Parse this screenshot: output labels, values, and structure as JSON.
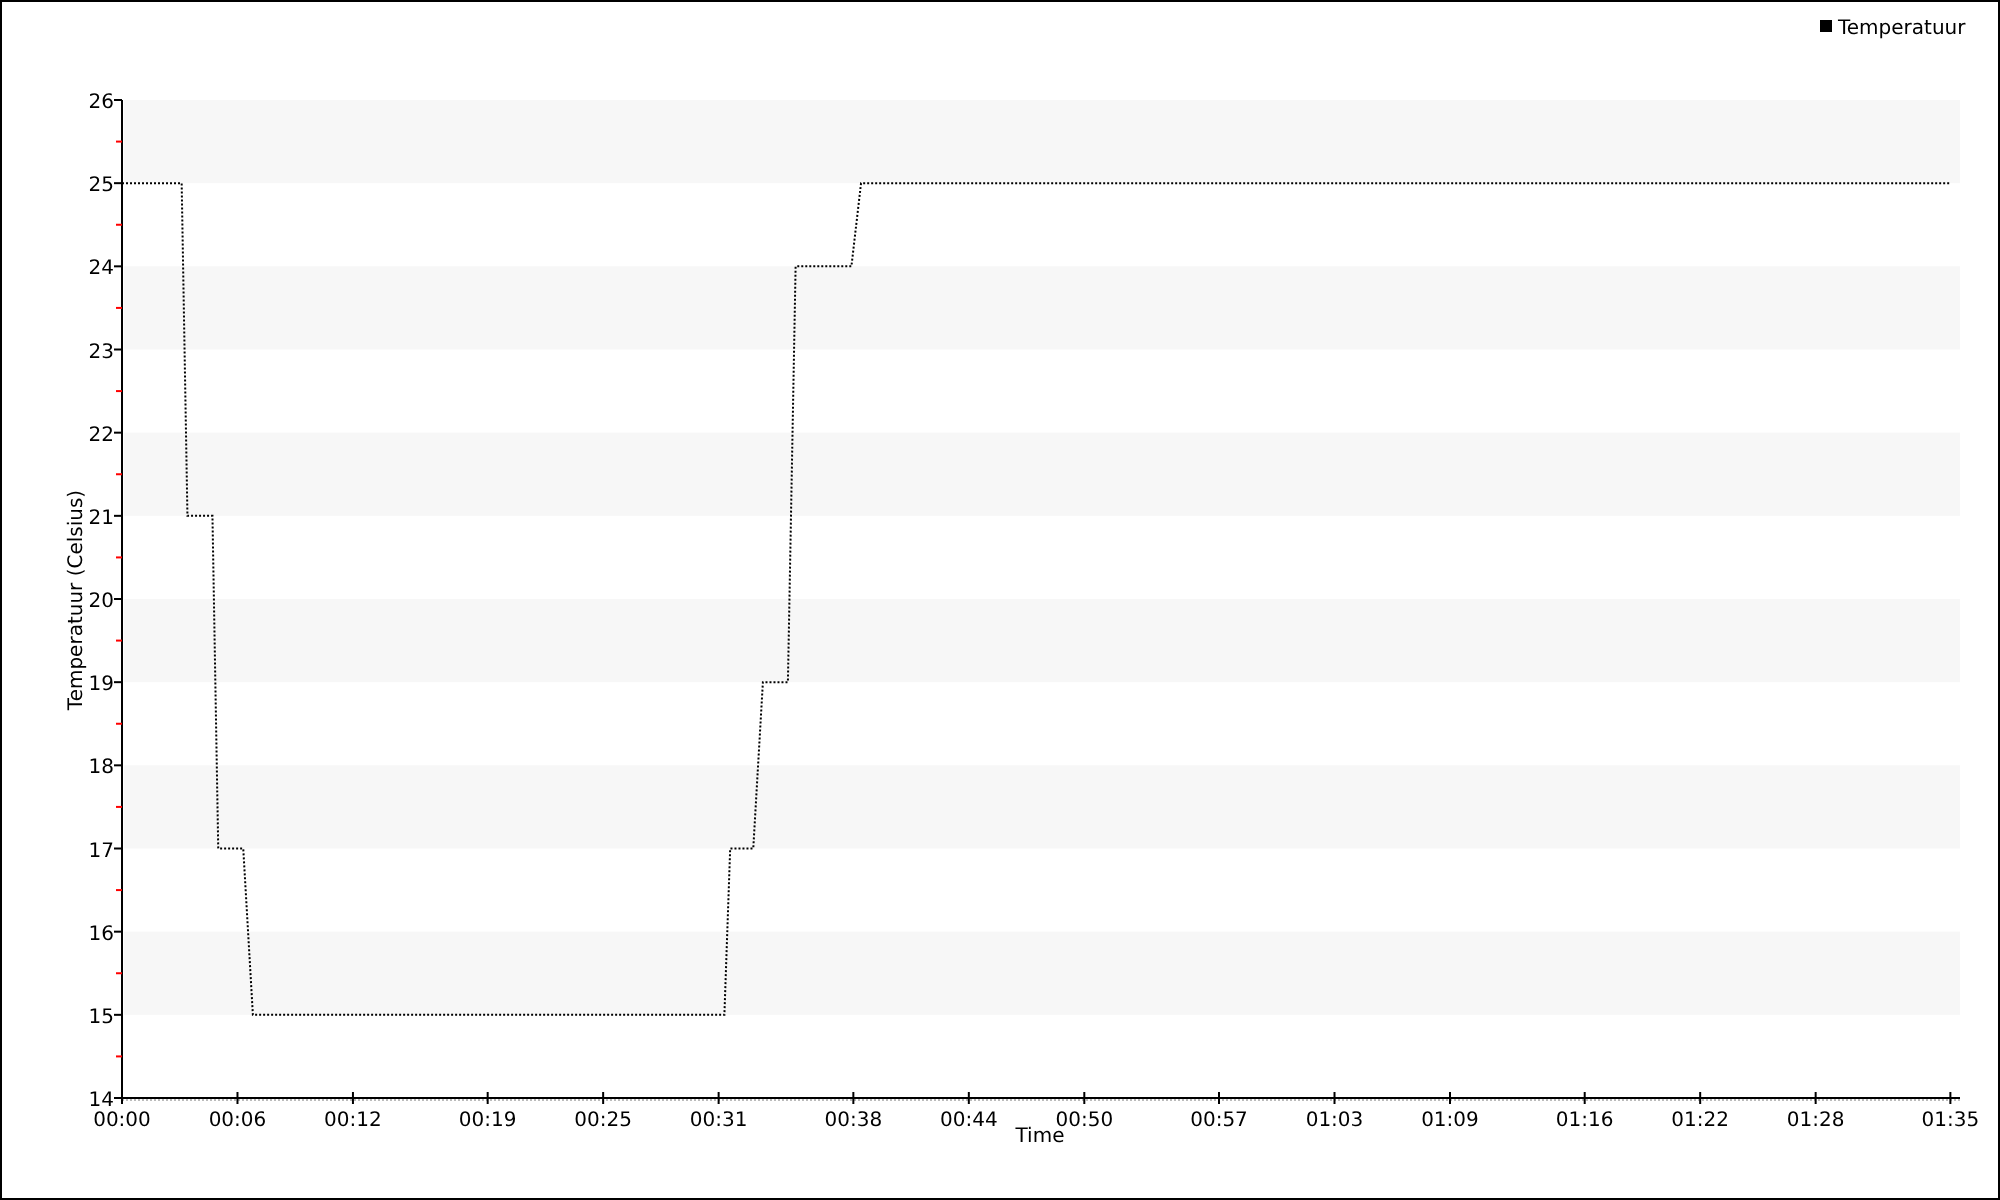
{
  "chart_data": {
    "type": "line",
    "xlabel": "Time",
    "ylabel": "Temperatuur (Celsius)",
    "x": [
      0,
      3.1,
      3.4,
      4.7,
      5.0,
      6.3,
      6.8,
      31.3,
      31.6,
      32.8,
      33.3,
      34.6,
      35.0,
      37.9,
      38.4,
      95
    ],
    "series": [
      {
        "name": "Temperatuur",
        "color": "#000000",
        "line_style": "dotted",
        "values": [
          25,
          25,
          21,
          21,
          17,
          17,
          15,
          15,
          17,
          17,
          19,
          19,
          24,
          24,
          25,
          25
        ]
      }
    ],
    "xlim": [
      0,
      95.5
    ],
    "ylim": [
      14,
      26
    ],
    "xticks": [
      {
        "value": 0,
        "label": "00:00"
      },
      {
        "value": 6,
        "label": "00:06"
      },
      {
        "value": 12,
        "label": "00:12"
      },
      {
        "value": 19,
        "label": "00:19"
      },
      {
        "value": 25,
        "label": "00:25"
      },
      {
        "value": 31,
        "label": "00:31"
      },
      {
        "value": 38,
        "label": "00:38"
      },
      {
        "value": 44,
        "label": "00:44"
      },
      {
        "value": 50,
        "label": "00:50"
      },
      {
        "value": 57,
        "label": "00:57"
      },
      {
        "value": 63,
        "label": "01:03"
      },
      {
        "value": 69,
        "label": "01:09"
      },
      {
        "value": 76,
        "label": "01:16"
      },
      {
        "value": 82,
        "label": "01:22"
      },
      {
        "value": 88,
        "label": "01:28"
      },
      {
        "value": 95,
        "label": "01:35"
      }
    ],
    "yticks": [
      14,
      15,
      16,
      17,
      18,
      19,
      20,
      21,
      22,
      23,
      24,
      25,
      26
    ]
  }
}
